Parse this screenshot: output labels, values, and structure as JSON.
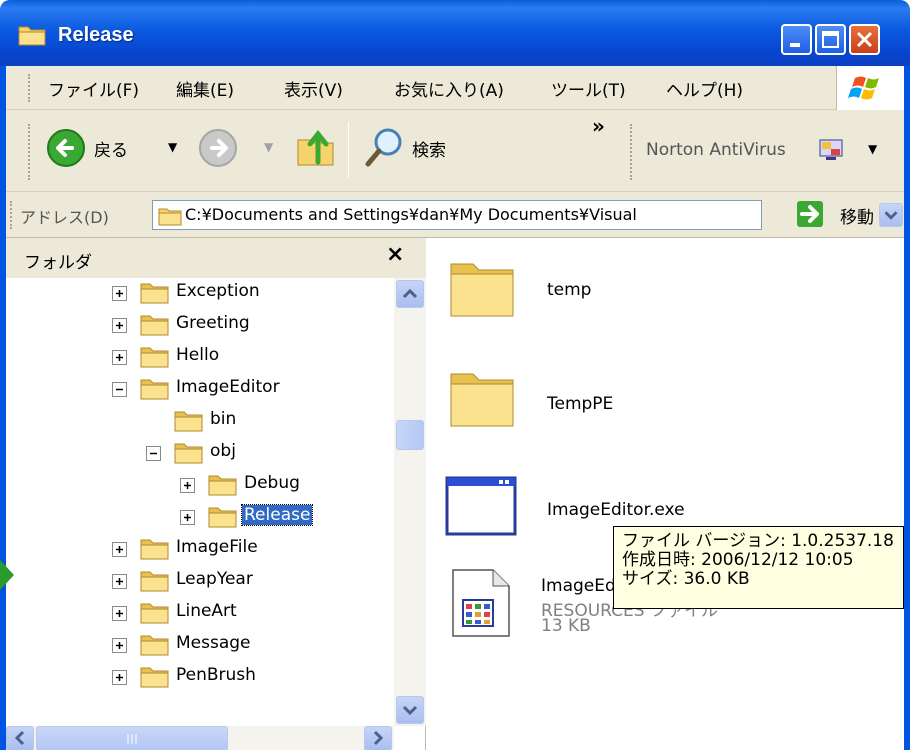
{
  "window": {
    "title": "Release",
    "controls": {
      "minimize": "minimize",
      "maximize": "maximize",
      "close": "close"
    }
  },
  "menu": {
    "items": [
      "ファイル(F)",
      "編集(E)",
      "表示(V)",
      "お気に入り(A)",
      "ツール(T)",
      "ヘルプ(H)"
    ]
  },
  "toolbar": {
    "back_label": "戻る",
    "search_label": "検索",
    "overflow_label": "»",
    "norton_label": "Norton AntiVirus"
  },
  "address": {
    "label": "アドレス(D)",
    "value": "C:¥Documents and Settings¥dan¥My Documents¥Visual",
    "go_label": "移動"
  },
  "folder_pane": {
    "title": "フォルダ",
    "close_label": "×",
    "tree": [
      {
        "label": "Exception",
        "level": 0,
        "expander": "plus"
      },
      {
        "label": "Greeting",
        "level": 0,
        "expander": "plus"
      },
      {
        "label": "Hello",
        "level": 0,
        "expander": "plus"
      },
      {
        "label": "ImageEditor",
        "level": 0,
        "expander": "minus"
      },
      {
        "label": "bin",
        "level": 1,
        "expander": "none"
      },
      {
        "label": "obj",
        "level": 1,
        "expander": "minus"
      },
      {
        "label": "Debug",
        "level": 2,
        "expander": "plus"
      },
      {
        "label": "Release",
        "level": 2,
        "expander": "plus",
        "selected": true
      },
      {
        "label": "ImageFile",
        "level": 0,
        "expander": "plus"
      },
      {
        "label": "LeapYear",
        "level": 0,
        "expander": "plus"
      },
      {
        "label": "LineArt",
        "level": 0,
        "expander": "plus"
      },
      {
        "label": "Message",
        "level": 0,
        "expander": "plus"
      },
      {
        "label": "PenBrush",
        "level": 0,
        "expander": "plus"
      }
    ]
  },
  "files": [
    {
      "name": "temp",
      "icon": "folder-icon"
    },
    {
      "name": "TempPE",
      "icon": "folder-icon"
    },
    {
      "name": "ImageEditor.exe",
      "icon": "exe-window-icon"
    },
    {
      "name": "ImageEd",
      "type": "RESOURCES ファイル",
      "size": "13 KB",
      "icon": "resources-file-icon"
    }
  ],
  "tooltip": {
    "version": "ファイル バージョン: 1.0.2537.18",
    "created": "作成日時: 2006/12/12 10:05",
    "size": "サイズ: 36.0 KB"
  },
  "colors": {
    "titlebar": "#0a5fd8",
    "selection": "#316ac5",
    "tooltip_bg": "#ffffe1",
    "chrome": "#ece9d8"
  }
}
